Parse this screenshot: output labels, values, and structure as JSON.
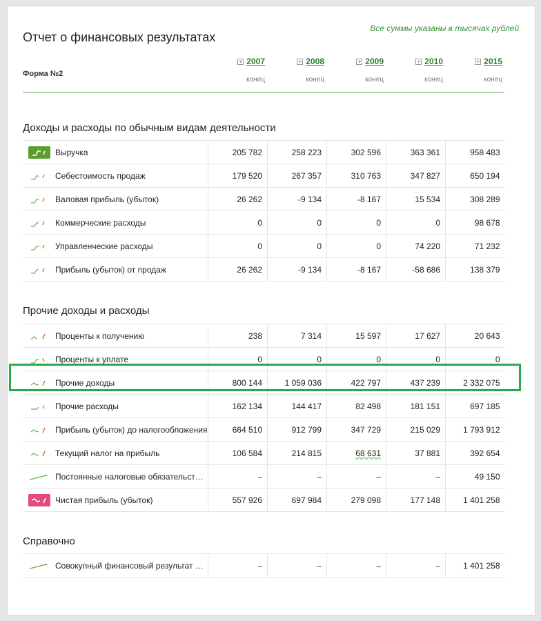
{
  "header": {
    "title": "Отчет о финансовых результатах",
    "note": "Все суммы указаны в тысячах рублей",
    "form_label": "Форма №2",
    "years": [
      "2007",
      "2008",
      "2009",
      "2010",
      "2015"
    ],
    "period_label": "конец"
  },
  "sections": [
    {
      "title": "Доходы и расходы по обычным видам деятельности",
      "rows": [
        {
          "label": "Выручка",
          "values": [
            "205 782",
            "258 223",
            "302 596",
            "363 361",
            "958 483"
          ],
          "spark": "green-box"
        },
        {
          "label": "Себестоимость продаж",
          "values": [
            "179 520",
            "267 357",
            "310 763",
            "347 827",
            "650 194"
          ],
          "spark": "rise"
        },
        {
          "label": "Валовая прибыль (убыток)",
          "values": [
            "26 262",
            "-9 134",
            "-8 167",
            "15 534",
            "308 289"
          ],
          "spark": "rise"
        },
        {
          "label": "Коммерческие расходы",
          "values": [
            "0",
            "0",
            "0",
            "0",
            "98 678"
          ],
          "spark": "rise"
        },
        {
          "label": "Управленческие расходы",
          "values": [
            "0",
            "0",
            "0",
            "74 220",
            "71 232"
          ],
          "spark": "rise"
        },
        {
          "label": "Прибыль (убыток) от продаж",
          "values": [
            "26 262",
            "-9 134",
            "-8 167",
            "-58 686",
            "138 379"
          ],
          "spark": "rise"
        }
      ]
    },
    {
      "title": "Прочие доходы и расходы",
      "rows": [
        {
          "label": "Проценты к получению",
          "values": [
            "238",
            "7 314",
            "15 597",
            "17 627",
            "20 643"
          ],
          "spark": "wave-up"
        },
        {
          "label": "Проценты к уплате",
          "values": [
            "0",
            "0",
            "0",
            "0",
            "0"
          ],
          "spark": "rise-down"
        },
        {
          "label": "Прочие доходы",
          "values": [
            "800 144",
            "1 059 036",
            "422 797",
            "437 239",
            "2 332 075"
          ],
          "spark": "dip-up"
        },
        {
          "label": "Прочие расходы",
          "values": [
            "162 134",
            "144 417",
            "82 498",
            "181 151",
            "697 185"
          ],
          "spark": "flat-up"
        },
        {
          "label": "Прибыль (убыток) до налогообложения",
          "values": [
            "664 510",
            "912 799",
            "347 729",
            "215 029",
            "1 793 912"
          ],
          "spark": "dip-up"
        },
        {
          "label": "Текущий налог на прибыль",
          "values": [
            "106 584",
            "214 815",
            "68 631",
            "37 881",
            "392 654"
          ],
          "spark": "dip-up"
        },
        {
          "label": "Постоянные налоговые обязательст…",
          "values": [
            "–",
            "–",
            "–",
            "–",
            "49 150"
          ],
          "spark": "line"
        },
        {
          "label": "Чистая прибыль (убыток)",
          "values": [
            "557 926",
            "697 984",
            "279 098",
            "177 148",
            "1 401 258"
          ],
          "spark": "pink-box"
        }
      ]
    },
    {
      "title": "Справочно",
      "rows": [
        {
          "label": "Совокупный финансовый результат …",
          "values": [
            "–",
            "–",
            "–",
            "–",
            "1 401 258"
          ],
          "spark": "line"
        }
      ]
    }
  ],
  "highlight_row": "Прочие доходы",
  "colors": {
    "accent": "#2d7d2d",
    "highlight": "#2aa84a",
    "negative_marker": "#d9534f",
    "net_profit_box": "#e44b7b"
  }
}
